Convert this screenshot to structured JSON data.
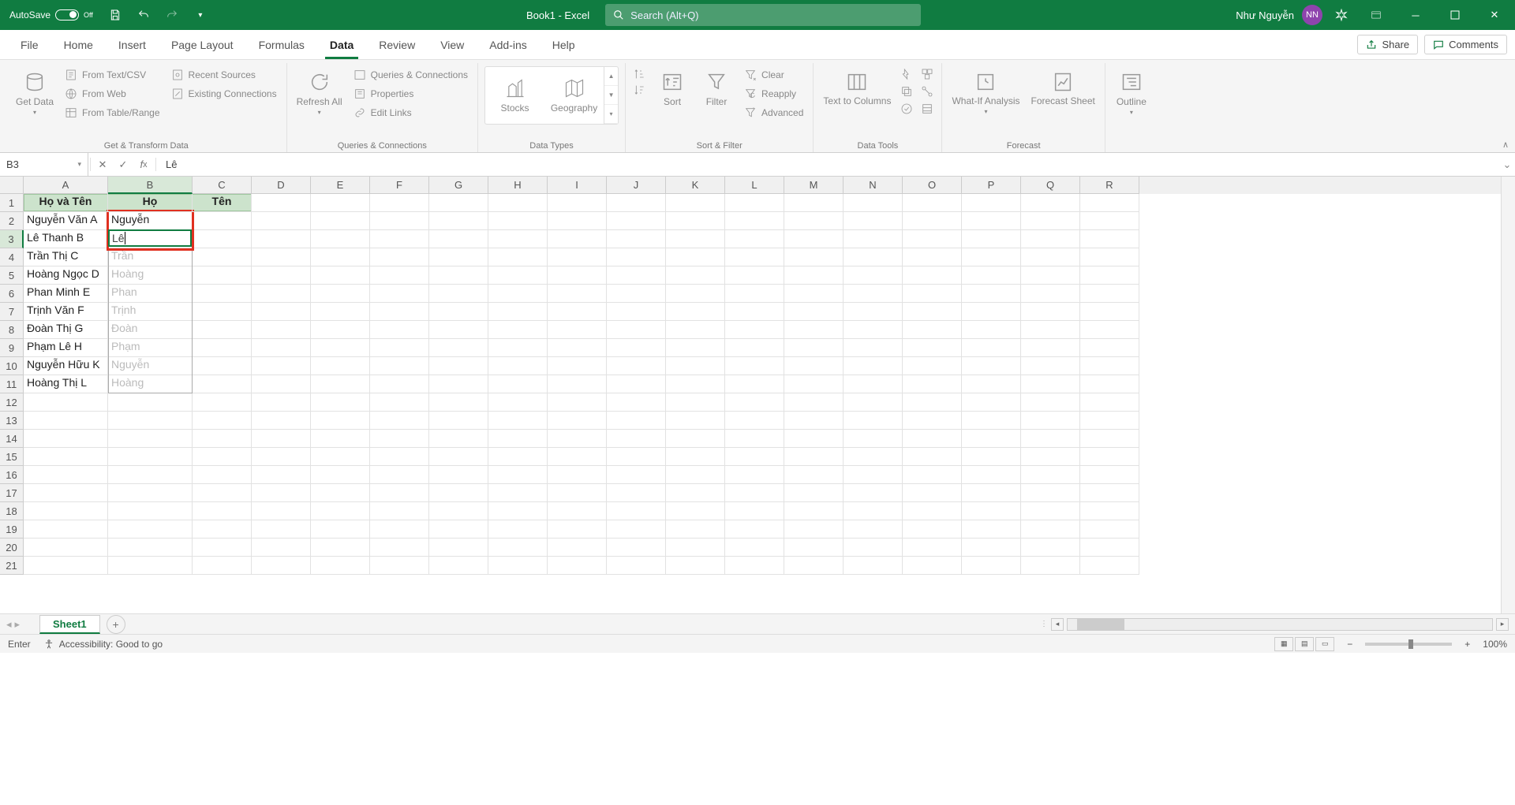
{
  "titlebar": {
    "autosave_label": "AutoSave",
    "autosave_state": "Off",
    "doc_title": "Book1  -  Excel",
    "search_placeholder": "Search (Alt+Q)",
    "user_name": "Như Nguyễn",
    "user_initials": "NN"
  },
  "tabs": [
    "File",
    "Home",
    "Insert",
    "Page Layout",
    "Formulas",
    "Data",
    "Review",
    "View",
    "Add-ins",
    "Help"
  ],
  "active_tab": "Data",
  "share_label": "Share",
  "comments_label": "Comments",
  "ribbon": {
    "get_data": "Get Data",
    "from_text_csv": "From Text/CSV",
    "from_web": "From Web",
    "from_table": "From Table/Range",
    "recent_sources": "Recent Sources",
    "existing_conn": "Existing Connections",
    "group1": "Get & Transform Data",
    "refresh_all": "Refresh All",
    "queries_conn": "Queries & Connections",
    "properties": "Properties",
    "edit_links": "Edit Links",
    "group2": "Queries & Connections",
    "stocks": "Stocks",
    "geography": "Geography",
    "group3": "Data Types",
    "sort": "Sort",
    "filter": "Filter",
    "clear": "Clear",
    "reapply": "Reapply",
    "advanced": "Advanced",
    "group4": "Sort & Filter",
    "text_to_columns": "Text to Columns",
    "group5": "Data Tools",
    "whatif": "What-If Analysis",
    "forecast_sheet": "Forecast Sheet",
    "group6": "Forecast",
    "outline": "Outline"
  },
  "name_box": "B3",
  "formula_value": "Lê",
  "columns": [
    "A",
    "B",
    "C",
    "D",
    "E",
    "F",
    "G",
    "H",
    "I",
    "J",
    "K",
    "L",
    "M",
    "N",
    "O",
    "P",
    "Q",
    "R"
  ],
  "col_widths": {
    "A": 107,
    "B": 107,
    "C": 75,
    "default": 75
  },
  "selected_row": 3,
  "selected_col": "B",
  "header_highlight": {
    "cols": [
      "A",
      "B",
      "C"
    ],
    "row": 1
  },
  "rows": [
    {
      "r": 1,
      "A": "Họ và Tên",
      "B": "Họ",
      "C": "Tên",
      "header": true
    },
    {
      "r": 2,
      "A": "Nguyễn Văn A",
      "B": "Nguyễn"
    },
    {
      "r": 3,
      "A": "Lê Thanh B",
      "B": "Lê",
      "editing": true
    },
    {
      "r": 4,
      "A": "Trần Thị C",
      "B": "Trần",
      "ghost": true
    },
    {
      "r": 5,
      "A": "Hoàng Ngọc D",
      "B": "Hoàng",
      "ghost": true
    },
    {
      "r": 6,
      "A": "Phan Minh E",
      "B": "Phan",
      "ghost": true
    },
    {
      "r": 7,
      "A": "Trịnh Văn F",
      "B": "Trịnh",
      "ghost": true
    },
    {
      "r": 8,
      "A": "Đoàn Thị G",
      "B": "Đoàn",
      "ghost": true
    },
    {
      "r": 9,
      "A": "Phạm Lê H",
      "B": "Phạm",
      "ghost": true
    },
    {
      "r": 10,
      "A": "Nguyễn Hữu K",
      "B": "Nguyễn",
      "ghost": true
    },
    {
      "r": 11,
      "A": "Hoàng Thị L",
      "B": "Hoàng",
      "ghost": true
    }
  ],
  "total_rows": 21,
  "sheet_tab": "Sheet1",
  "status_mode": "Enter",
  "accessibility": "Accessibility: Good to go",
  "zoom": "100%"
}
